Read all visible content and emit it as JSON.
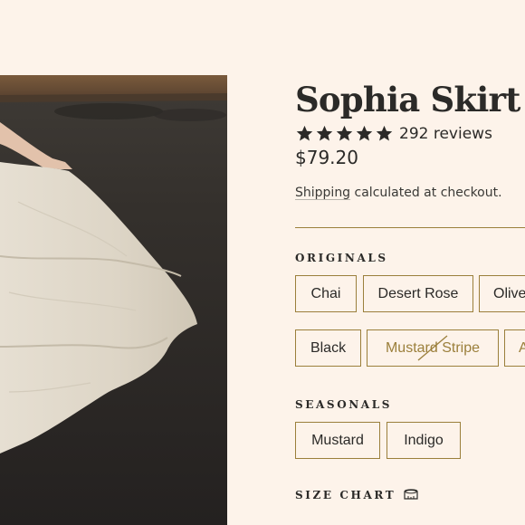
{
  "product": {
    "title": "Sophia Skirt",
    "rating_stars": 5,
    "reviews": "292 reviews",
    "price": "$79.20",
    "shipping_link": "Shipping",
    "shipping_rest": " calculated at checkout."
  },
  "originals": {
    "label": "ORIGINALS",
    "row1": [
      "Chai",
      "Desert Rose",
      "Olive"
    ],
    "row2": [
      "Black",
      "Mustard Stripe",
      "A"
    ]
  },
  "seasonals": {
    "label": "SEASONALS",
    "options": [
      "Mustard",
      "Indigo"
    ]
  },
  "size_chart": {
    "label": "SIZE CHART",
    "icon": "ruler-icon"
  },
  "colors": {
    "background": "#fdf3ea",
    "accent": "#9b7f3b",
    "text": "#2b2a28"
  }
}
